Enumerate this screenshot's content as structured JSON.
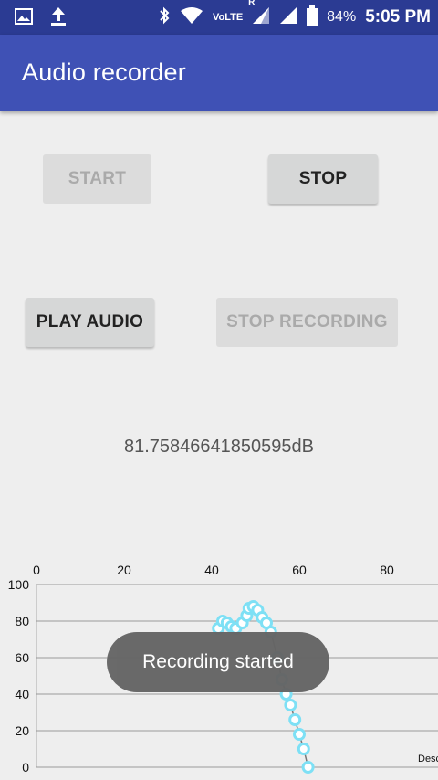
{
  "status_bar": {
    "icons": [
      "image-icon",
      "upload-icon",
      "bluetooth-icon",
      "wifi-icon",
      "signal-icon",
      "signal-icon-2",
      "battery-icon"
    ],
    "volte_label": "VoLTE",
    "roaming_label": "R",
    "battery_percent": "84%",
    "time": "5:05 PM"
  },
  "app_bar": {
    "title": "Audio recorder",
    "color": "#3f51b5"
  },
  "buttons": {
    "start": "START",
    "stop": "STOP",
    "play_audio": "PLAY AUDIO",
    "stop_recording": "STOP RECORDING"
  },
  "button_state": {
    "start_enabled": false,
    "stop_enabled": true,
    "play_audio_enabled": true,
    "stop_recording_enabled": false
  },
  "readout": {
    "decibel": "81.75846641850595dB"
  },
  "toast": {
    "message": "Recording started"
  },
  "chart_data": {
    "type": "scatter",
    "x_ticks": [
      "0",
      "20",
      "40",
      "60",
      "80"
    ],
    "y_ticks": [
      "0",
      "20",
      "40",
      "60",
      "80",
      "100"
    ],
    "xlim": [
      0,
      100
    ],
    "ylim": [
      0,
      100
    ],
    "corner_label": "Desc",
    "marker_color": "#7ee0f5",
    "line_color": "#777777",
    "series": [
      {
        "points": [
          [
            41.5,
            76
          ],
          [
            42.5,
            80
          ],
          [
            43.5,
            79
          ],
          [
            44.5,
            77
          ],
          [
            45.5,
            76
          ],
          [
            47,
            79
          ],
          [
            48,
            83
          ],
          [
            48.5,
            87
          ],
          [
            49.5,
            88
          ],
          [
            50.5,
            86
          ],
          [
            51.5,
            82
          ],
          [
            52.5,
            79
          ],
          [
            53.5,
            74
          ],
          [
            55,
            60
          ],
          [
            56,
            48
          ],
          [
            57,
            40
          ],
          [
            58,
            34
          ],
          [
            59,
            26
          ],
          [
            60,
            18
          ],
          [
            61,
            10
          ],
          [
            62,
            0
          ]
        ]
      }
    ]
  }
}
